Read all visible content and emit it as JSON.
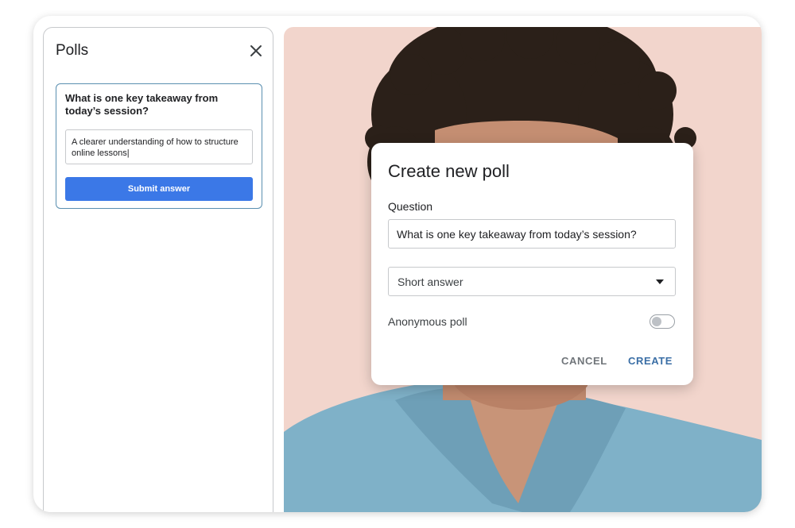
{
  "polls_panel": {
    "title": "Polls",
    "close_icon": "close-icon",
    "poll_question": "What is one key takeaway from today’s session?",
    "answer_value": "A clearer understanding of how to structure online lessons|",
    "submit_label": "Submit answer"
  },
  "dialog": {
    "title": "Create new poll",
    "question_label": "Question",
    "question_value": "What is one key takeaway from today’s session?",
    "answer_type": "Short answer",
    "anonymous_label": "Anonymous poll",
    "anonymous_enabled": false,
    "cancel_label": "CANCEL",
    "create_label": "CREATE"
  },
  "colors": {
    "primary_button": "#3b78e7",
    "create_text": "#3b6fa6",
    "video_background": "#f2d5cc",
    "shirt": "#7fb1c8"
  }
}
